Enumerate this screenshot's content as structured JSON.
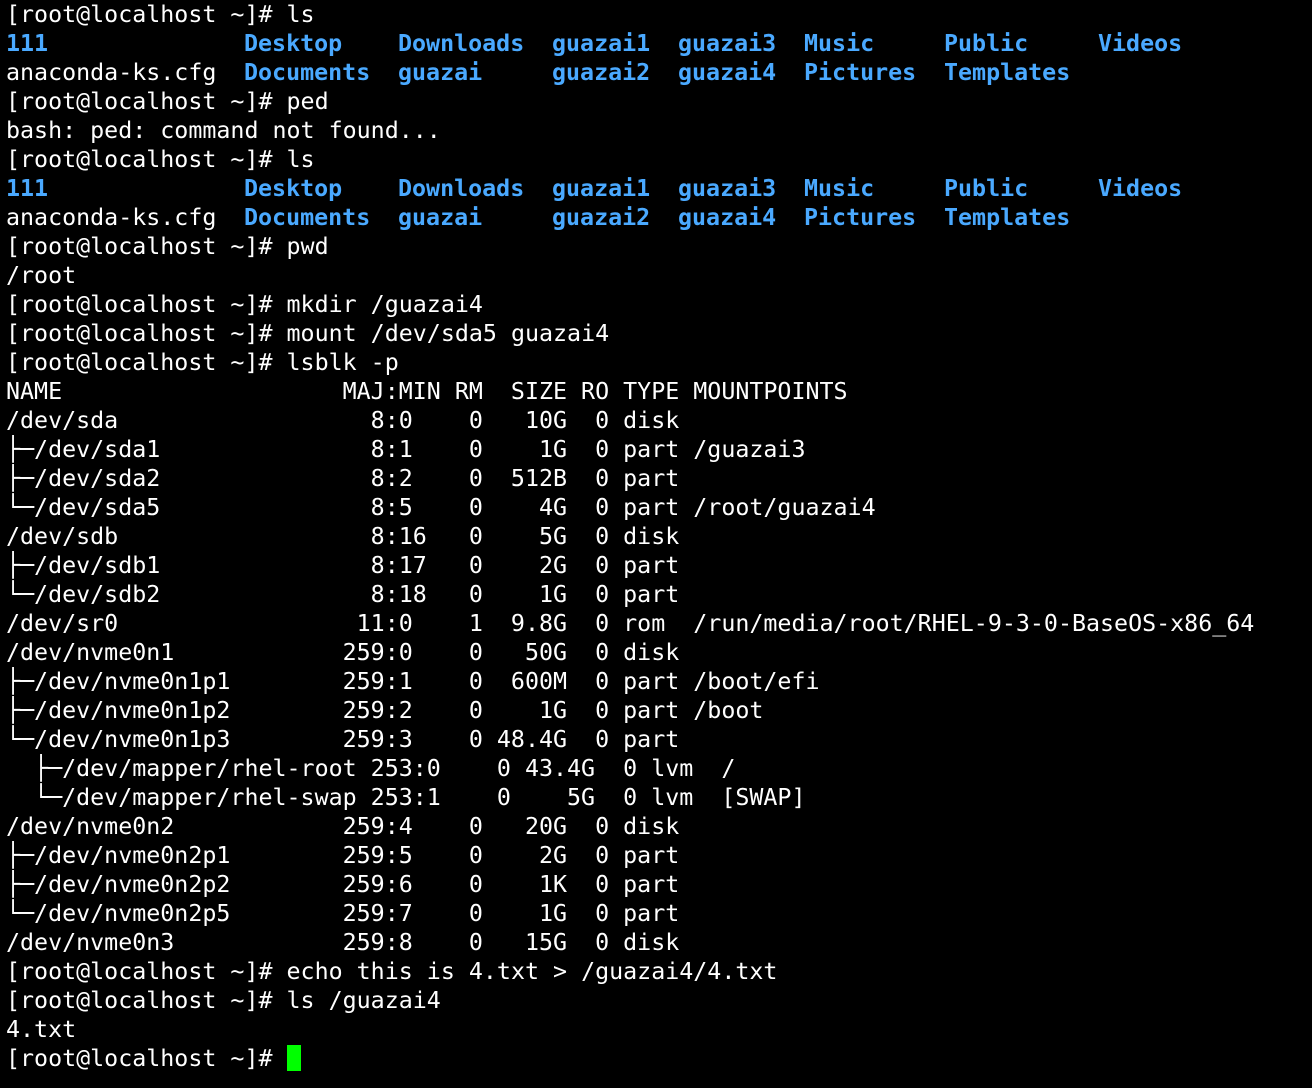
{
  "colors": {
    "background": "#000000",
    "text": "#ffffff",
    "directory": "#4aa9ff",
    "cursor": "#00ff00"
  },
  "prompt": "[root@localhost ~]# ",
  "commands": {
    "c1": "ls",
    "c2": "ped",
    "c3": "ls",
    "c4": "pwd",
    "c5": "mkdir /guazai4",
    "c6": "mount /dev/sda5 guazai4",
    "c7": "lsblk -p",
    "c8": "echo this is 4.txt > /guazai4/4.txt",
    "c9": "ls /guazai4",
    "c10": ""
  },
  "outputs": {
    "ped_error": "bash: ped: command not found...",
    "pwd": "/root",
    "ls_guazai4": "4.txt"
  },
  "ls_listing": {
    "row1": [
      "111",
      "Desktop",
      "Downloads",
      "guazai1",
      "guazai3",
      "Music",
      "Public",
      "Videos"
    ],
    "row2": [
      "anaconda-ks.cfg",
      "Documents",
      "guazai",
      "guazai2",
      "guazai4",
      "Pictures",
      "Templates"
    ]
  },
  "lsblk": {
    "header": "NAME                    MAJ:MIN RM  SIZE RO TYPE MOUNTPOINTS",
    "rows": [
      "/dev/sda                  8:0    0   10G  0 disk",
      "├─/dev/sda1               8:1    0    1G  0 part /guazai3",
      "├─/dev/sda2               8:2    0  512B  0 part",
      "└─/dev/sda5               8:5    0    4G  0 part /root/guazai4",
      "/dev/sdb                  8:16   0    5G  0 disk",
      "├─/dev/sdb1               8:17   0    2G  0 part",
      "└─/dev/sdb2               8:18   0    1G  0 part",
      "/dev/sr0                 11:0    1  9.8G  0 rom  /run/media/root/RHEL-9-3-0-BaseOS-x86_64",
      "/dev/nvme0n1            259:0    0   50G  0 disk",
      "├─/dev/nvme0n1p1        259:1    0  600M  0 part /boot/efi",
      "├─/dev/nvme0n1p2        259:2    0    1G  0 part /boot",
      "└─/dev/nvme0n1p3        259:3    0 48.4G  0 part",
      "  ├─/dev/mapper/rhel-root 253:0    0 43.4G  0 lvm  /",
      "  └─/dev/mapper/rhel-swap 253:1    0    5G  0 lvm  [SWAP]",
      "/dev/nvme0n2            259:4    0   20G  0 disk",
      "├─/dev/nvme0n2p1        259:5    0    2G  0 part",
      "├─/dev/nvme0n2p2        259:6    0    1K  0 part",
      "└─/dev/nvme0n2p5        259:7    0    1G  0 part",
      "/dev/nvme0n3            259:8    0   15G  0 disk"
    ]
  }
}
